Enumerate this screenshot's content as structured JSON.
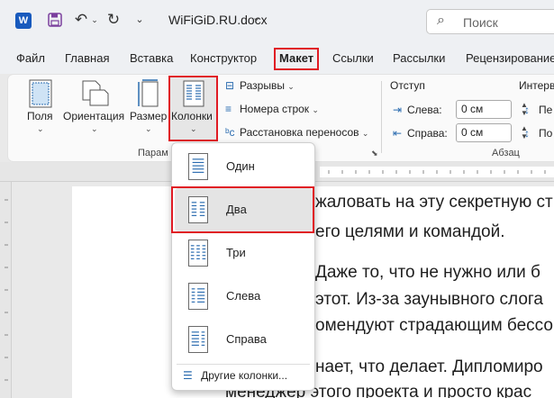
{
  "titlebar": {
    "app_logo": "W",
    "doc_title": "WiFiGiD.RU.docx",
    "search_placeholder": "Поиск"
  },
  "tabs": [
    "Файл",
    "Главная",
    "Вставка",
    "Конструктор",
    "Макет",
    "Ссылки",
    "Рассылки",
    "Рецензирование"
  ],
  "active_tab": "Макет",
  "ribbon": {
    "fields_label": "Поля",
    "orientation_label": "Ориентация",
    "size_label": "Размер",
    "columns_label": "Колонки",
    "breaks_label": "Разрывы",
    "line_numbers_label": "Номера строк",
    "hyphenation_label": "Расстановка переносов",
    "group_page_setup": "Парам",
    "indent_header": "Отступ",
    "interval_header": "Интерв",
    "left_label": "Слева:",
    "right_label": "Справа:",
    "left_value": "0 см",
    "right_value": "0 см",
    "before_short": "Пе",
    "after_short": "По",
    "group_paragraph": "Абзац"
  },
  "columns_menu": {
    "items": [
      {
        "label": "Один"
      },
      {
        "label": "Два"
      },
      {
        "label": "Три"
      },
      {
        "label": "Слева"
      },
      {
        "label": "Справа"
      }
    ],
    "selected": "Два",
    "more_label": "Другие колонки..."
  },
  "document": {
    "lines": [
      "жаловать на эту секретную ст",
      "его целями и командой.",
      "Даже то, что не нужно или б",
      "этот. Из-за заунывного слога",
      "омендуют страдающим бессо",
      "нает, что делает. Дипломиро",
      "менеджер этого проекта и просто крас"
    ]
  },
  "colors": {
    "highlight": "#e01b24",
    "word_blue": "#185abd"
  }
}
